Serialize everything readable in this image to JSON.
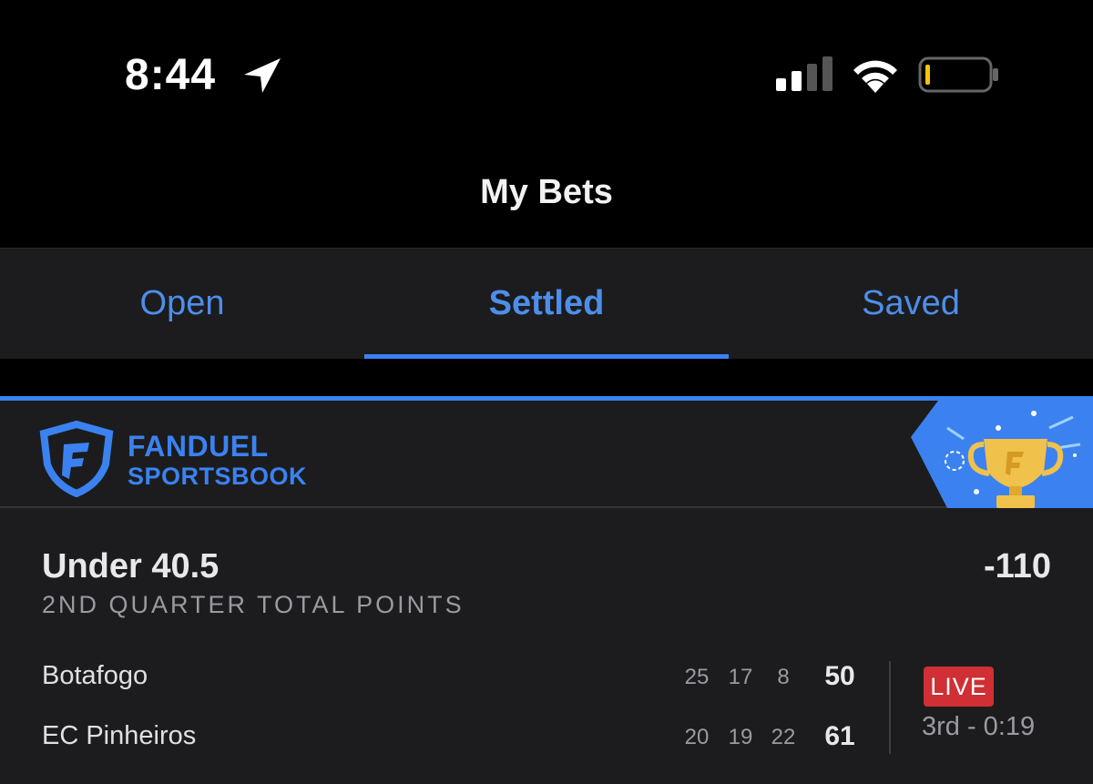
{
  "status_bar": {
    "time": "8:44",
    "icons": [
      "location-arrow-icon",
      "cellular-signal-icon",
      "wifi-icon",
      "battery-low-icon"
    ]
  },
  "header": {
    "title": "My Bets"
  },
  "tabs": [
    {
      "label": "Open",
      "active": false
    },
    {
      "label": "Settled",
      "active": true
    },
    {
      "label": "Saved",
      "active": false
    }
  ],
  "bet_card": {
    "brand_line1": "FANDUEL",
    "brand_line2": "SPORTSBOOK",
    "badge_icon": "trophy-icon",
    "selection": "Under 40.5",
    "odds": "-110",
    "market": "2ND QUARTER TOTAL POINTS",
    "teams": [
      {
        "name": "Botafogo",
        "q1": "25",
        "q2": "17",
        "q3": "8",
        "total": "50"
      },
      {
        "name": "EC Pinheiros",
        "q1": "20",
        "q2": "19",
        "q3": "22",
        "total": "61"
      }
    ],
    "status_badge": "LIVE",
    "game_clock": "3rd - 0:19"
  },
  "colors": {
    "accent": "#3b82f0",
    "live": "#cf2f35",
    "card_bg": "#1c1c1e",
    "battery_low": "#f5c400"
  }
}
